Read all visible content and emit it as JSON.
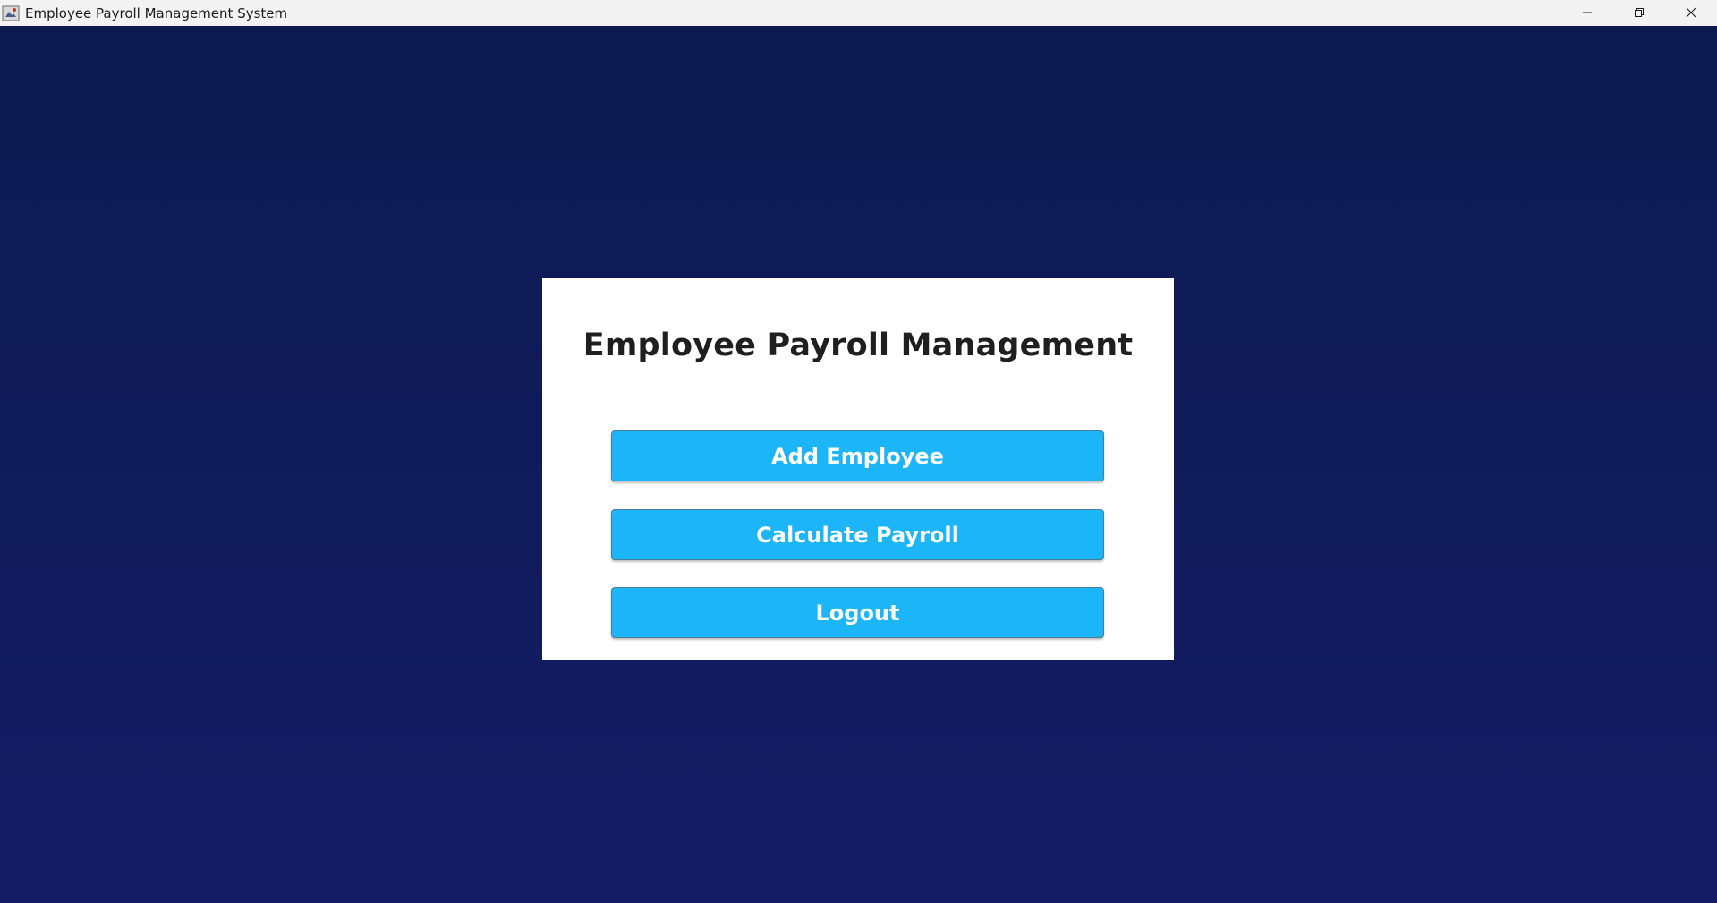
{
  "window": {
    "title": "Employee Payroll Management System",
    "icon": "java-app-icon",
    "controls": [
      "minimize-icon",
      "restore-icon",
      "close-icon"
    ]
  },
  "main": {
    "heading": "Employee Payroll Management",
    "buttons": [
      {
        "label": "Add Employee"
      },
      {
        "label": "Calculate Payroll"
      },
      {
        "label": "Logout"
      }
    ]
  },
  "colors": {
    "background_top": "#0c1a4f",
    "background_bottom": "#151d66",
    "card": "#ffffff",
    "button": "#1cb6f8",
    "button_text": "#ffffff",
    "heading_text": "#1f1f1f"
  }
}
